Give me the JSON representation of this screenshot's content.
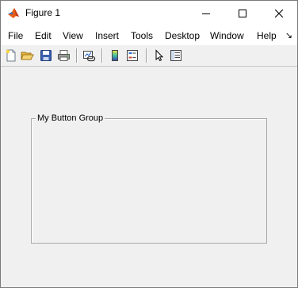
{
  "window": {
    "title": "Figure 1"
  },
  "menu": {
    "items": [
      "File",
      "Edit",
      "View",
      "Insert",
      "Tools",
      "Desktop",
      "Window",
      "Help"
    ],
    "more": "↘"
  },
  "toolbar": {
    "icons": [
      "new-figure-icon",
      "open-file-icon",
      "save-icon",
      "print-icon",
      "link-plot-icon",
      "insert-colorbar-icon",
      "insert-legend-icon",
      "pointer-icon",
      "property-inspector-icon"
    ]
  },
  "button_group": {
    "title": "My Button Group"
  },
  "colors": {
    "figure_background": "#f0f0f0",
    "titlebar": "#ffffff",
    "group_border": "#a8a8a8"
  }
}
